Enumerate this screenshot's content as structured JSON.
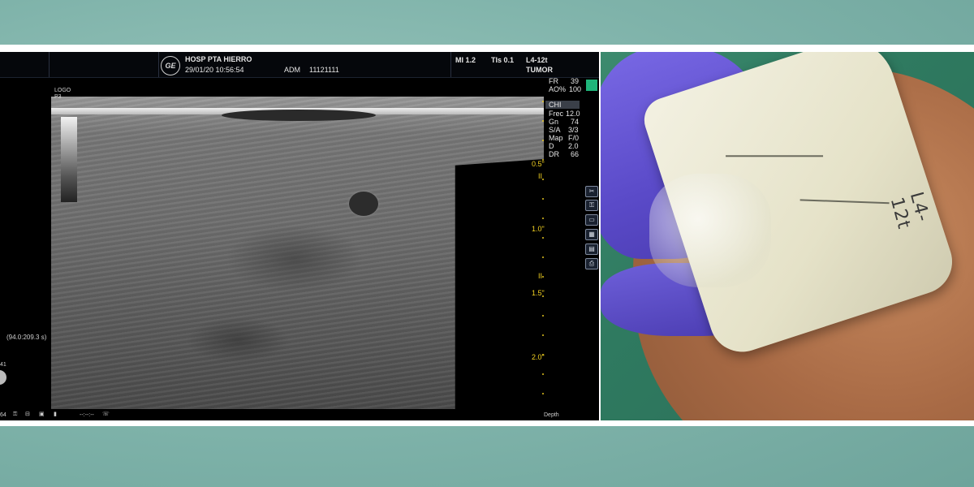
{
  "header": {
    "hospital": "HOSP PTA HIERRO",
    "datetime": "29/01/20 10:56:54",
    "operator": "ADM",
    "patient_id": "11121111",
    "mi": "MI 1.2",
    "tis": "TIs 0.1",
    "probe": "L4-12t",
    "preset": "TUMOR",
    "logo": "GE"
  },
  "params": [
    {
      "label": "FR",
      "value": "39"
    },
    {
      "label": "AO%",
      "value": "100"
    },
    {
      "label": "CHI",
      "value": ""
    },
    {
      "label": "Frec",
      "value": "12.0"
    },
    {
      "label": "Gn",
      "value": "74"
    },
    {
      "label": "S/A",
      "value": "3/3"
    },
    {
      "label": "Map",
      "value": "F/0"
    },
    {
      "label": "D",
      "value": "2.0"
    },
    {
      "label": "DR",
      "value": "66"
    }
  ],
  "depth_scale": [
    "0.5\"",
    "1.0\"",
    "1.5\"",
    "2.0\""
  ],
  "focus_marker": "II",
  "image_logo": "LOGO\nP3",
  "cine": "(94.0:209.3 s)",
  "left_marker": "41",
  "bottom_bar": {
    "left_number": "64",
    "status": "--:--:--",
    "depth_label": "Depth"
  },
  "photo": {
    "probe_label": "L4-12t"
  },
  "icons": {
    "side": [
      "scissors-icon",
      "lock-icon",
      "monitor-icon",
      "grid-icon",
      "save-icon",
      "print-icon"
    ],
    "bottom": [
      "lock-icon",
      "probe-icon",
      "camera-icon",
      "battery-icon",
      "phone-icon"
    ]
  },
  "colors": {
    "indicator": "#1fb57a",
    "caliper": "#f2d021"
  }
}
